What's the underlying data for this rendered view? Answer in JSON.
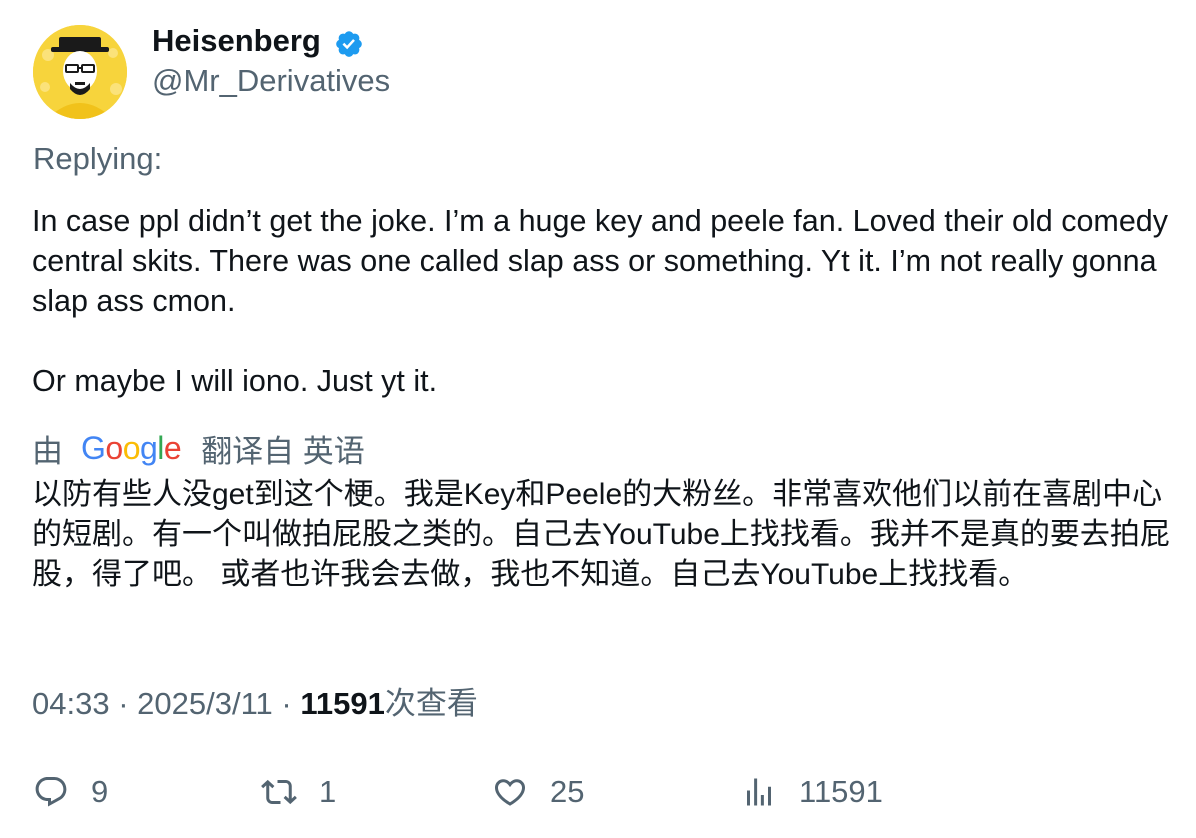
{
  "author": {
    "name": "Heisenberg",
    "handle": "@Mr_Derivatives",
    "verified": true,
    "avatar_icon": "heisenberg-avatar"
  },
  "replying_label": "Replying:",
  "tweet_text": "In case ppl didn’t get the joke. I’m a huge key and peele fan. Loved their old comedy central skits. There was one called slap ass or something. Yt it. I’m not really gonna slap ass cmon.\n\nOr maybe I will iono. Just yt it.",
  "translation": {
    "by_label": "由",
    "provider": "Google",
    "from_label": "翻译自 英语",
    "text": "以防有些人没get到这个梗。我是Key和Peele的大粉丝。非常喜欢他们以前在喜剧中心的短剧。有一个叫做拍屁股之类的。自己去YouTube上找找看。我并不是真的要去拍屁股，得了吧。 或者也许我会去做，我也不知道。自己去YouTube上找找看。"
  },
  "meta": {
    "time": "04:33",
    "separator": "·",
    "date": "2025/3/11",
    "views_count": "11591",
    "views_label": "次查看"
  },
  "actions": {
    "replies": "9",
    "retweets": "1",
    "likes": "25",
    "views": "11591"
  },
  "colors": {
    "secondary_text": "#536471",
    "primary_text": "#0f1419",
    "verified_blue": "#1d9bf0",
    "google_blue": "#4285F4",
    "google_red": "#EA4335",
    "google_yellow": "#FBBC05",
    "google_green": "#34A853"
  }
}
